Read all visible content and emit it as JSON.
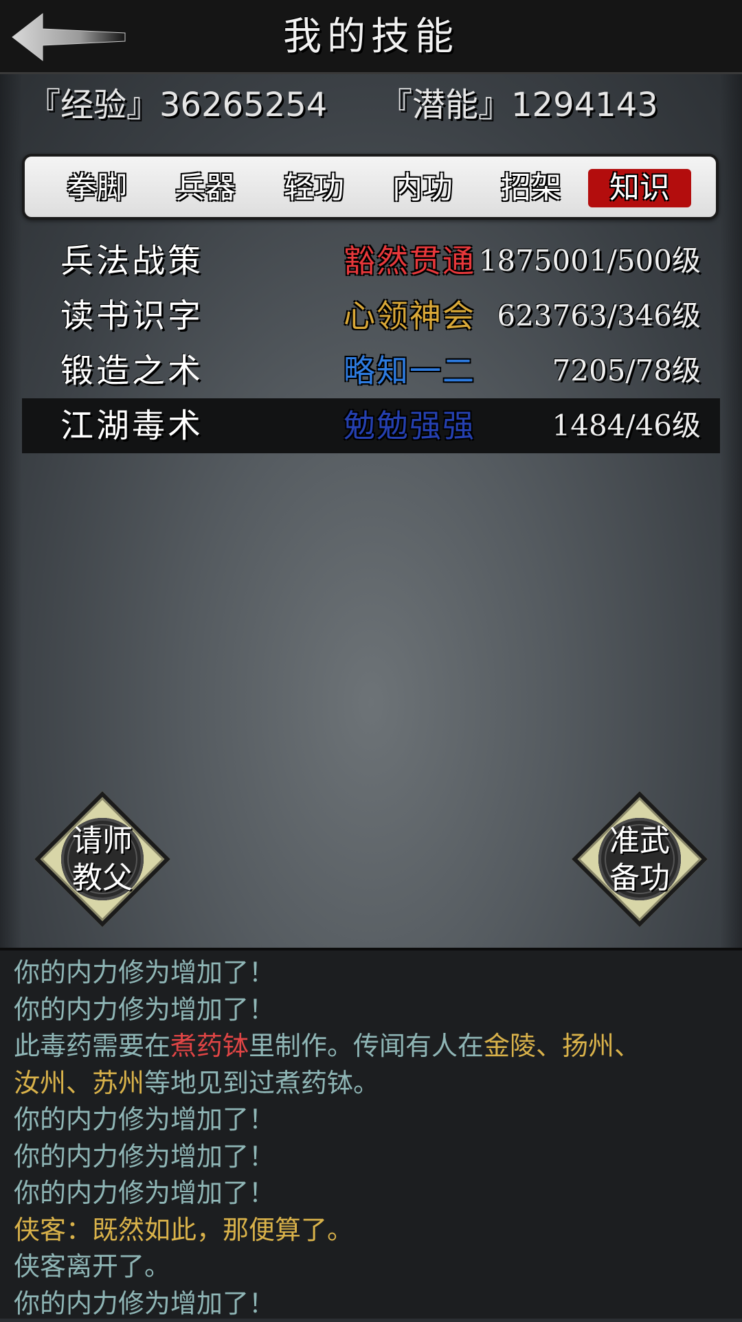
{
  "header": {
    "title": "我的技能"
  },
  "stats": {
    "experience": "『经验』36265254",
    "potential": "『潜能』1294143"
  },
  "tabs": [
    "拳脚",
    "兵器",
    "轻功",
    "内功",
    "招架",
    "知识"
  ],
  "active_tab": "知识",
  "skills": [
    {
      "name": "兵法战策",
      "rank": "豁然贯通",
      "rank_color": "#e8383b",
      "level": "1875001/500级"
    },
    {
      "name": "读书识字",
      "rank": "心领神会",
      "rank_color": "#d9a838",
      "level": "623763/346级"
    },
    {
      "name": "锻造之术",
      "rank": "略知一二",
      "rank_color": "#2d7be0",
      "level": "7205/78级"
    },
    {
      "name": "江湖毒术",
      "rank": "勉勉强强",
      "rank_color": "#2540b0",
      "level": "1484/46级"
    }
  ],
  "buttons": {
    "left": {
      "line1": "请师",
      "line2": "教父"
    },
    "right": {
      "line1": "准武",
      "line2": "备功"
    }
  },
  "log": {
    "line1": "你的内力修为增加了！",
    "line2": "你的内力修为增加了！",
    "line3": {
      "a": "此毒药需要在",
      "b": "煮药钵",
      "c": "里制作。传闻有人在",
      "d": "金陵、扬州、"
    },
    "line4": {
      "a": "汝州、苏州",
      "b": "等地见到过煮药钵。"
    },
    "line5": "你的内力修为增加了！",
    "line6": "你的内力修为增加了！",
    "line7": "你的内力修为增加了！",
    "line8": "侠客：既然如此，那便算了。",
    "line9": "侠客离开了。",
    "line10": "你的内力修为增加了！"
  },
  "colors": {
    "accent_red": "#b30d0d",
    "log_text": "#8fb6b6",
    "log_gold": "#d9b24a",
    "log_red": "#e04545"
  }
}
